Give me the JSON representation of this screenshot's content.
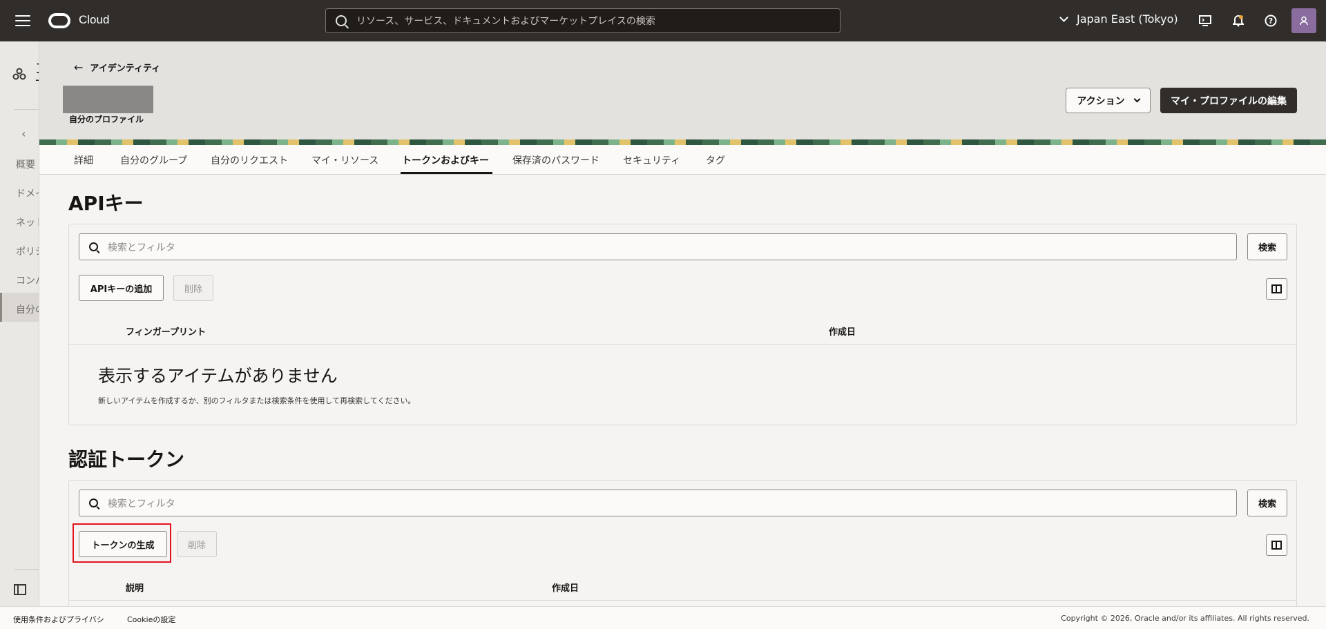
{
  "topbar": {
    "brand": "Cloud",
    "search_placeholder": "リソース、サービス、ドキュメントおよびマーケットプレイスの検索",
    "region": "Japan East (Tokyo)"
  },
  "rail": {
    "items": [
      "概要",
      "ドメイ",
      "ネット",
      "ポリシ",
      "コンパ",
      "自分の"
    ],
    "top_glyph_line1": "コ",
    "top_glyph_line2": "+"
  },
  "header": {
    "back_label": "アイデンティティ",
    "profile_label": "自分のプロファイル",
    "action_button": "アクション",
    "edit_button": "マイ・プロファイルの編集"
  },
  "tabs": [
    {
      "label": "詳細"
    },
    {
      "label": "自分のグループ"
    },
    {
      "label": "自分のリクエスト"
    },
    {
      "label": "マイ・リソース"
    },
    {
      "label": "トークンおよびキー",
      "active": true
    },
    {
      "label": "保存済のパスワード"
    },
    {
      "label": "セキュリティ"
    },
    {
      "label": "タグ"
    }
  ],
  "api_keys": {
    "title": "APIキー",
    "filter_placeholder": "検索とフィルタ",
    "search_button": "検索",
    "add_button": "APIキーの追加",
    "delete_button": "削除",
    "columns": [
      "フィンガープリント",
      "作成日"
    ],
    "empty_title": "表示するアイテムがありません",
    "empty_desc": "新しいアイテムを作成するか、別のフィルタまたは検索条件を使用して再検索してください。"
  },
  "auth_tokens": {
    "title": "認証トークン",
    "filter_placeholder": "検索とフィルタ",
    "search_button": "検索",
    "generate_button": "トークンの生成",
    "delete_button": "削除",
    "columns": [
      "説明",
      "作成日"
    ]
  },
  "footer": {
    "terms": "使用条件およびプライバシ",
    "cookies": "Cookieの設定",
    "copyright": "Copyright © 2026, Oracle and/or its affiliates. All rights reserved."
  },
  "colors": {
    "topbar": "#312d2a",
    "highlight": "#e0121b"
  }
}
